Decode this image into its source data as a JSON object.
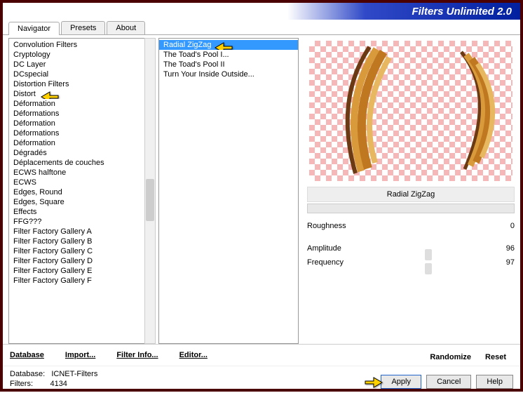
{
  "title": "Filters Unlimited 2.0",
  "tabs": [
    "Navigator",
    "Presets",
    "About"
  ],
  "active_tab": 0,
  "categories": [
    "Convolution Filters",
    "Cryptology",
    "DC Layer",
    "DCspecial",
    "Distortion Filters",
    "Distort",
    "Déformation",
    "Déformations",
    "Déformation",
    "Déformations",
    "Déformation",
    "Dégradés",
    "Déplacements de couches",
    "ECWS halftone",
    "ECWS",
    "Edges, Round",
    "Edges, Square",
    "Effects",
    "FFG???",
    "Filter Factory Gallery A",
    "Filter Factory Gallery B",
    "Filter Factory Gallery C",
    "Filter Factory Gallery D",
    "Filter Factory Gallery E",
    "Filter Factory Gallery F"
  ],
  "selected_category_index": 5,
  "filters": [
    "Radial ZigZag",
    "The Toad's Pool I...",
    "The Toad's Pool II",
    "Turn Your Inside Outside..."
  ],
  "selected_filter_index": 0,
  "current_filter_name": "Radial ZigZag",
  "params": [
    {
      "name": "Roughness",
      "value": 0,
      "thumb_pct": 0
    },
    {
      "name": "Amplitude",
      "value": 96,
      "thumb_pct": 50
    },
    {
      "name": "Frequency",
      "value": 97,
      "thumb_pct": 50
    }
  ],
  "bottom_links": {
    "database": "Database",
    "import": "Import...",
    "filter_info": "Filter Info...",
    "editor": "Editor...",
    "randomize": "Randomize",
    "reset": "Reset"
  },
  "status": {
    "db_label": "Database:",
    "db_value": "ICNET-Filters",
    "filters_label": "Filters:",
    "filters_value": "4134"
  },
  "buttons": {
    "apply": "Apply",
    "cancel": "Cancel",
    "help": "Help"
  }
}
